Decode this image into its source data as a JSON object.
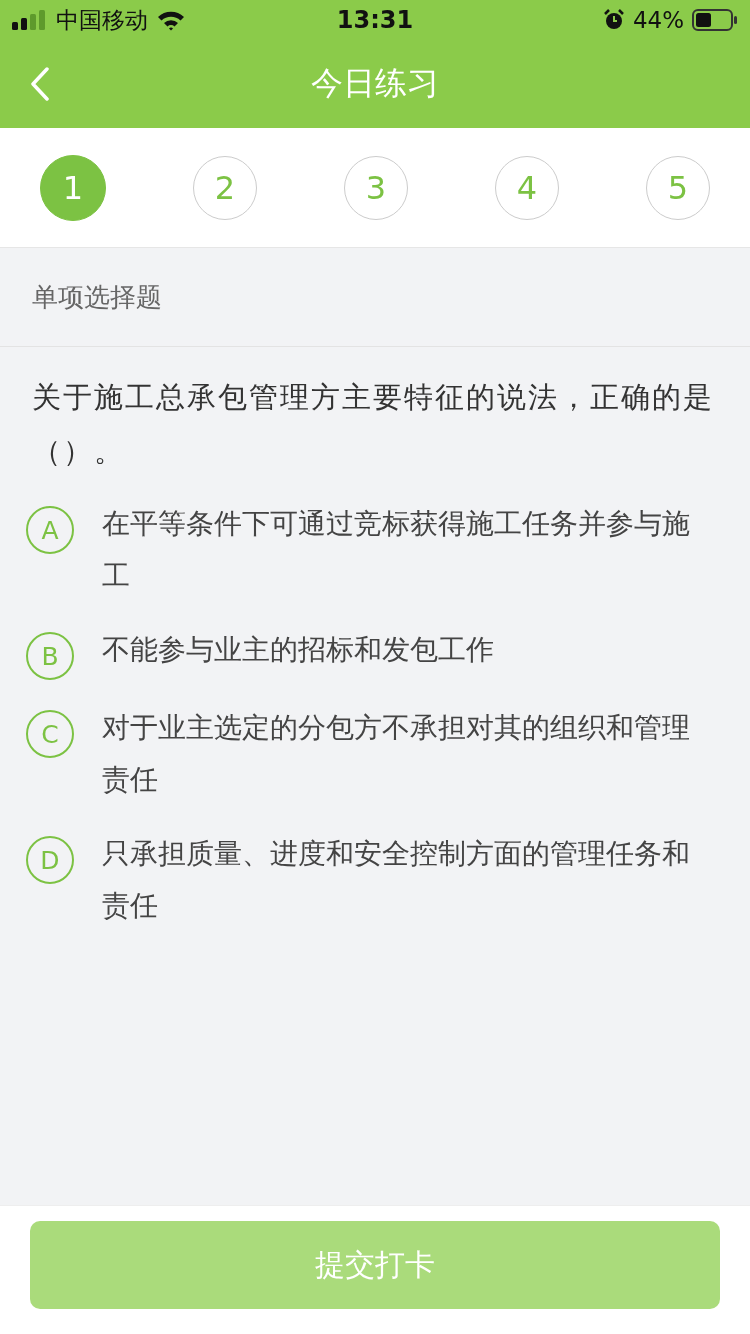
{
  "status_bar": {
    "carrier": "中国移动",
    "time": "13:31",
    "battery": "44%"
  },
  "nav": {
    "title": "今日练习"
  },
  "question_tabs": [
    {
      "label": "1",
      "selected": true
    },
    {
      "label": "2",
      "selected": false
    },
    {
      "label": "3",
      "selected": false
    },
    {
      "label": "4",
      "selected": false
    },
    {
      "label": "5",
      "selected": false
    }
  ],
  "section_title": "单项选择题",
  "question": "关于施工总承包管理方主要特征的说法，正确的是（）。",
  "options": [
    {
      "letter": "A",
      "text": "在平等条件下可通过竞标获得施工任务并参与施工",
      "selected": false
    },
    {
      "letter": "B",
      "text": "不能参与业主的招标和发包工作",
      "selected": false
    },
    {
      "letter": "C",
      "text": "对于业主选定的分包方不承担对其的组织和管理责任",
      "selected": false
    },
    {
      "letter": "D",
      "text": "只承担质量、进度和安全控制方面的管理任务和责任",
      "selected": false
    }
  ],
  "submit_button": {
    "label": "提交打卡",
    "disabled": true
  }
}
